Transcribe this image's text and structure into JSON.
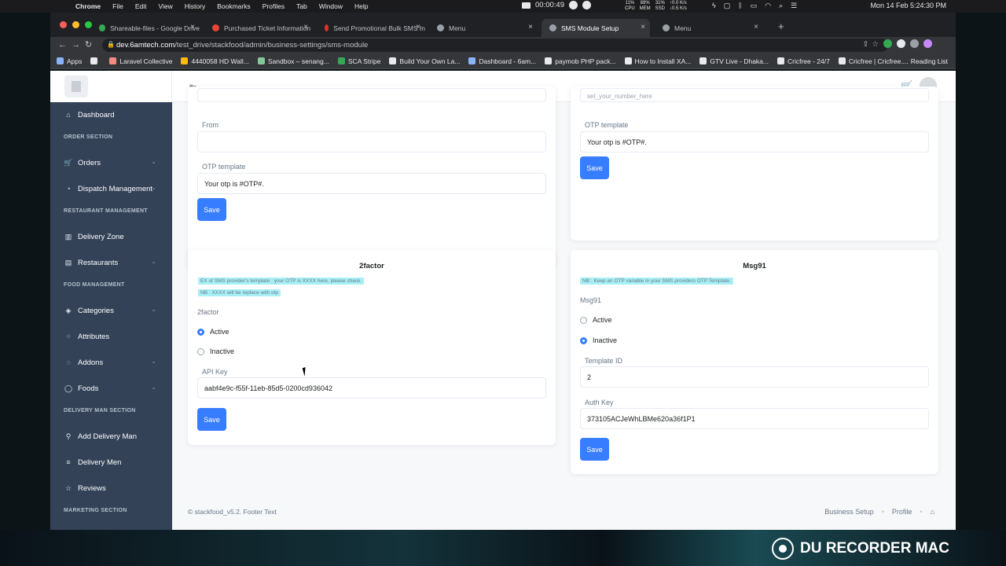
{
  "menubar": {
    "items": [
      "Chrome",
      "File",
      "Edit",
      "View",
      "History",
      "Bookmarks",
      "Profiles",
      "Tab",
      "Window",
      "Help"
    ],
    "rec_time": "00:00:49",
    "stats": [
      [
        "11%",
        "CPU"
      ],
      [
        "88%",
        "MEM"
      ],
      [
        "31%",
        "SSD"
      ],
      [
        "↑0.0 K/s",
        "↓0.5 K/s"
      ]
    ],
    "clock": "Mon 14 Feb  5:24:30 PM"
  },
  "tabs": [
    {
      "label": "Shareable-files - Google Drive",
      "color": "#34a853"
    },
    {
      "label": "Purchased Ticket Information",
      "color": "#ea4335"
    },
    {
      "label": "Send Promotional Bulk SMS In",
      "color": "#d93025"
    },
    {
      "label": "Menu",
      "color": "#9aa0a6"
    },
    {
      "label": "SMS Module Setup",
      "color": "#9aa0a6"
    },
    {
      "label": "Menu",
      "color": "#9aa0a6"
    }
  ],
  "address": {
    "host": "dev.6amtech.com",
    "path": "/test_drive/stackfood/admin/business-settings/sms-module"
  },
  "bookmarks": [
    {
      "label": "Apps",
      "color": "#8ab4f8"
    },
    {
      "label": "",
      "color": "#e8eaed"
    },
    {
      "label": "Laravel Collective",
      "color": "#f28b82"
    },
    {
      "label": "4440058 HD Wall...",
      "color": "#fbbc04"
    },
    {
      "label": "Sandbox – senang...",
      "color": "#81c995"
    },
    {
      "label": "SCA Stripe",
      "color": "#34a853"
    },
    {
      "label": "Build Your Own La...",
      "color": "#e8eaed"
    },
    {
      "label": "Dashboard - 6am...",
      "color": "#8ab4f8"
    },
    {
      "label": "paymob PHP pack...",
      "color": "#e8eaed"
    },
    {
      "label": "How to Install XA...",
      "color": "#e8eaed"
    },
    {
      "label": "GTV Live - Dhaka...",
      "color": "#e8eaed"
    },
    {
      "label": "Cricfree - 24/7",
      "color": "#e8eaed"
    },
    {
      "label": "Cricfree | Cricfree....",
      "color": "#e8eaed"
    }
  ],
  "reading_list": "Reading List",
  "sidebar": {
    "items": [
      {
        "type": "item",
        "label": "Dashboard",
        "icon": "home-icon",
        "glyph": "⌂",
        "chev": false
      },
      {
        "type": "section",
        "label": "ORDER SECTION"
      },
      {
        "type": "item",
        "label": "Orders",
        "icon": "cart-icon",
        "glyph": "🛒",
        "chev": true
      },
      {
        "type": "item",
        "label": "Dispatch Management",
        "icon": "dispatch-icon",
        "glyph": "◔",
        "chev": true
      },
      {
        "type": "section",
        "label": "RESTAURANT MANAGEMENT"
      },
      {
        "type": "item",
        "label": "Delivery Zone",
        "icon": "zone-icon",
        "glyph": "▥",
        "chev": false
      },
      {
        "type": "item",
        "label": "Restaurants",
        "icon": "restaurant-icon",
        "glyph": "▤",
        "chev": true
      },
      {
        "type": "section",
        "label": "FOOD MANAGEMENT"
      },
      {
        "type": "item",
        "label": "Categories",
        "icon": "category-icon",
        "glyph": "◈",
        "chev": true
      },
      {
        "type": "item",
        "label": "Attributes",
        "icon": "attribute-icon",
        "glyph": "⁘",
        "chev": false
      },
      {
        "type": "item",
        "label": "Addons",
        "icon": "addon-icon",
        "glyph": "◌",
        "chev": true
      },
      {
        "type": "item",
        "label": "Foods",
        "icon": "food-icon",
        "glyph": "◯",
        "chev": true
      },
      {
        "type": "section",
        "label": "DELIVERY MAN SECTION"
      },
      {
        "type": "item",
        "label": "Add Delivery Man",
        "icon": "running-man-icon",
        "glyph": "⚲",
        "chev": false
      },
      {
        "type": "item",
        "label": "Delivery Men",
        "icon": "list-icon",
        "glyph": "≡",
        "chev": false
      },
      {
        "type": "item",
        "label": "Reviews",
        "icon": "star-icon",
        "glyph": "☆",
        "chev": false
      },
      {
        "type": "section",
        "label": "MARKETING SECTION"
      }
    ]
  },
  "cards": {
    "top_left": {
      "from_label": "From",
      "from_value": "",
      "otp_label": "OTP template",
      "otp_value": "Your otp is #OTP#.",
      "save": "Save"
    },
    "top_right": {
      "partial_value": "set_your_number_here",
      "otp_label": "OTP template",
      "otp_value": "Your otp is #OTP#.",
      "save": "Save"
    },
    "twofactor": {
      "title": "2factor",
      "note1": "EX of SMS provider's template : your OTP is XXXX here, please check.",
      "note2": "NB : XXXX will be replace with otp",
      "section_label": "2factor",
      "active": "Active",
      "inactive": "Inactive",
      "api_label": "API Key",
      "api_value": "aabf4e9c-f55f-11eb-85d5-0200cd936042",
      "save": "Save"
    },
    "msg91": {
      "title": "Msg91",
      "note": "NB : Keep an OTP variable in your SMS providers OTP Template.",
      "section_label": "Msg91",
      "active": "Active",
      "inactive": "Inactive",
      "template_label": "Template ID",
      "template_value": "2",
      "auth_label": "Auth Key",
      "auth_value": "373105ACJeWhLBMe620a36f1P1",
      "save": "Save"
    }
  },
  "footer": {
    "text": "© stackfood_v5.2. Footer Text",
    "links": [
      "Business Setup",
      "Profile"
    ]
  },
  "watermark": "DU RECORDER MAC",
  "colors": {
    "sidebar": "#334257",
    "primary": "#377dff",
    "note_bg": "#a8f0f6"
  }
}
